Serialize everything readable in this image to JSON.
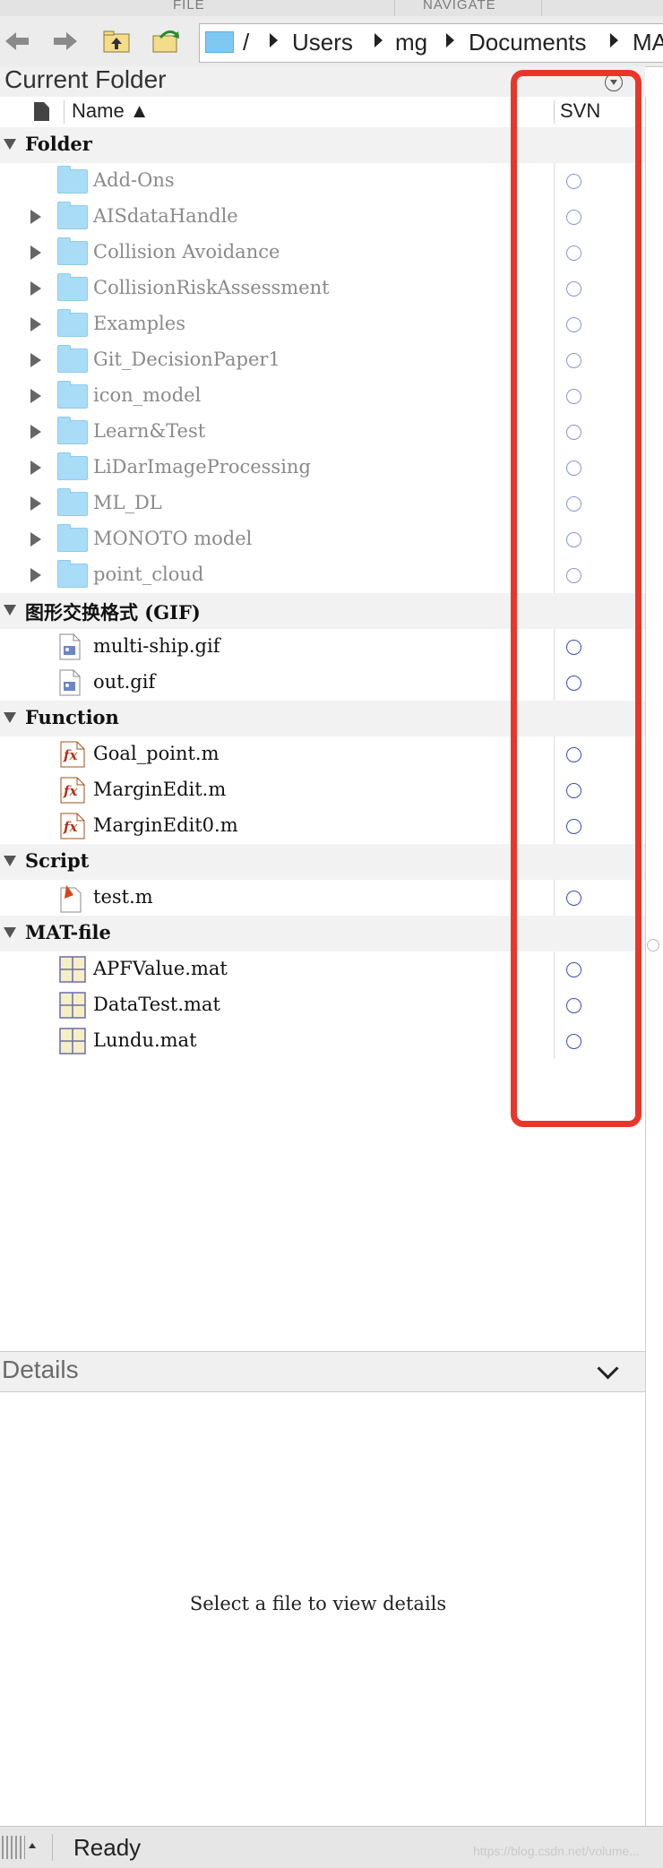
{
  "ribbon": {
    "tab_file": "FILE",
    "tab_navigate": "NAVIGATE"
  },
  "toolbar": {
    "back_icon": "left-arrow-icon",
    "forward_icon": "right-arrow-icon",
    "up_icon": "folder-up-icon",
    "browse_icon": "browse-folder-icon",
    "path": [
      "/",
      "Users",
      "mg",
      "Documents",
      "MA"
    ]
  },
  "panel": {
    "title": "Current Folder",
    "menu_icon": "panel-menu-icon",
    "col_name": "Name ▲",
    "col_svn": "SVN"
  },
  "groups": [
    {
      "label": "Folder",
      "items": [
        {
          "name": "Add-Ons",
          "expandable": false
        },
        {
          "name": "AISdataHandle",
          "expandable": true
        },
        {
          "name": "Collision Avoidance",
          "expandable": true
        },
        {
          "name": "CollisionRiskAssessment",
          "expandable": true
        },
        {
          "name": "Examples",
          "expandable": true
        },
        {
          "name": "Git_DecisionPaper1",
          "expandable": true
        },
        {
          "name": "icon_model",
          "expandable": true
        },
        {
          "name": "Learn&Test",
          "expandable": true
        },
        {
          "name": "LiDarImageProcessing",
          "expandable": true
        },
        {
          "name": "ML_DL",
          "expandable": true
        },
        {
          "name": "MONOTO model",
          "expandable": true
        },
        {
          "name": "point_cloud",
          "expandable": true
        }
      ]
    },
    {
      "label": "图形交换格式 (GIF)",
      "items": [
        {
          "name": "multi-ship.gif"
        },
        {
          "name": "out.gif"
        }
      ]
    },
    {
      "label": "Function",
      "items": [
        {
          "name": "Goal_point.m"
        },
        {
          "name": "MarginEdit.m"
        },
        {
          "name": "MarginEdit0.m"
        }
      ]
    },
    {
      "label": "Script",
      "items": [
        {
          "name": "test.m"
        }
      ]
    },
    {
      "label": "MAT-file",
      "items": [
        {
          "name": "APFValue.mat"
        },
        {
          "name": "DataTest.mat"
        },
        {
          "name": "Lundu.mat"
        }
      ]
    }
  ],
  "details": {
    "title": "Details",
    "placeholder": "Select a file to view details"
  },
  "status": {
    "text": "Ready"
  },
  "watermark": "https://blog.csdn.net/volume..."
}
